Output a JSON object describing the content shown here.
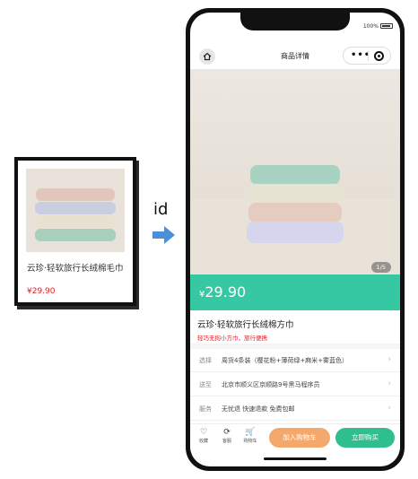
{
  "left_card": {
    "title": "云珍·轻软旅行长绒棉毛巾",
    "price": "¥29.90"
  },
  "connector": {
    "label": "id"
  },
  "phone": {
    "status": {
      "battery": "100%"
    },
    "nav": {
      "title": "商品详情",
      "more_icon": "•••"
    },
    "gallery": {
      "page_indicator": "1/5"
    },
    "price": {
      "currency": "¥",
      "amount": "29.90"
    },
    "product": {
      "title": "云珍·轻软旅行长绒棉方巾",
      "subtitle": "轻巧无拘小方巾，旅行便携"
    },
    "rows": [
      {
        "key": "选择",
        "value": "周货4条装（樱花粉+薄荷绿+麻米+雾蓝色）"
      },
      {
        "key": "送至",
        "value": "北京市顺义区京顺路9号黑马程序员"
      },
      {
        "key": "服务",
        "value": "无忧退 快速退款 免费包邮"
      }
    ],
    "tabbar": {
      "tabs": [
        {
          "icon": "♡",
          "label": "收藏"
        },
        {
          "icon": "⟳",
          "label": "客服"
        },
        {
          "icon": "🛒",
          "label": "购物车"
        }
      ],
      "cart_button": "加入购物车",
      "buy_button": "立即购买"
    }
  },
  "colors": {
    "accent": "#35c8a3",
    "price_red": "#e0202a",
    "cart_orange": "#f5a86b",
    "buy_green": "#2fbf8f"
  },
  "icons": [
    "home-icon",
    "more-icon",
    "target-icon",
    "arrow-right-icon",
    "heart-icon",
    "service-icon",
    "cart-icon",
    "chevron-right-icon"
  ]
}
